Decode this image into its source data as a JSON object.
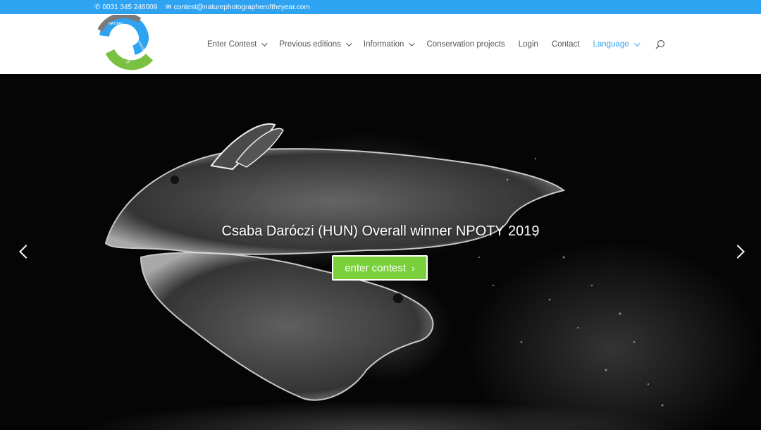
{
  "topbar": {
    "phone": "0031 345 246009",
    "email": "contest@naturephotographeroftheyear.com",
    "bg_color": "#2ea3f2"
  },
  "logo": {
    "text": "NATURE PHOTOGRAPHER OF THE YEAR"
  },
  "nav": {
    "items": [
      {
        "label": "Enter Contest",
        "dropdown": true
      },
      {
        "label": "Previous editions",
        "dropdown": true
      },
      {
        "label": "Information",
        "dropdown": true
      },
      {
        "label": "Conservation projects",
        "dropdown": false
      },
      {
        "label": "Login",
        "dropdown": false
      },
      {
        "label": "Contact",
        "dropdown": false
      },
      {
        "label": "Language",
        "dropdown": true
      }
    ],
    "accent_color": "#2ea3f2"
  },
  "hero": {
    "caption": "Csaba Daróczi (HUN) Overall winner NPOTY 2019",
    "cta_label": "enter contest",
    "cta_color": "#7ad03a"
  },
  "icons": {
    "phone": "phone-icon",
    "email": "envelope-icon",
    "search": "search-icon",
    "prev": "chevron-left-icon",
    "next": "chevron-right-icon"
  }
}
